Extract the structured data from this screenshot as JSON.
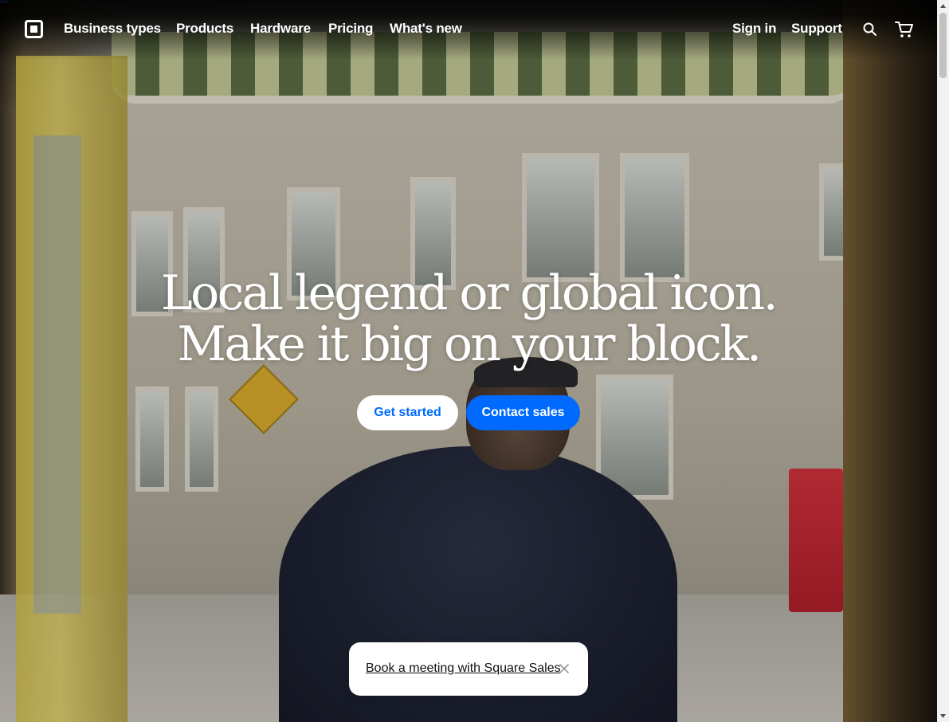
{
  "nav": {
    "logo": "square-logo",
    "links": [
      "Business types",
      "Products",
      "Hardware",
      "Pricing",
      "What's new"
    ],
    "sign_in": "Sign in",
    "support": "Support",
    "search_icon": "search-icon",
    "cart_icon": "cart-icon"
  },
  "hero": {
    "headline_line1": "Local legend or global icon.",
    "headline_line2": "Make it big on your block.",
    "secondary_button": "Get started",
    "primary_button": "Contact sales"
  },
  "toast": {
    "link_text": "Book a meeting with Square Sales",
    "close_icon": "close-icon"
  },
  "colors": {
    "accent": "#006aff",
    "text_on_dark": "#ffffff"
  }
}
